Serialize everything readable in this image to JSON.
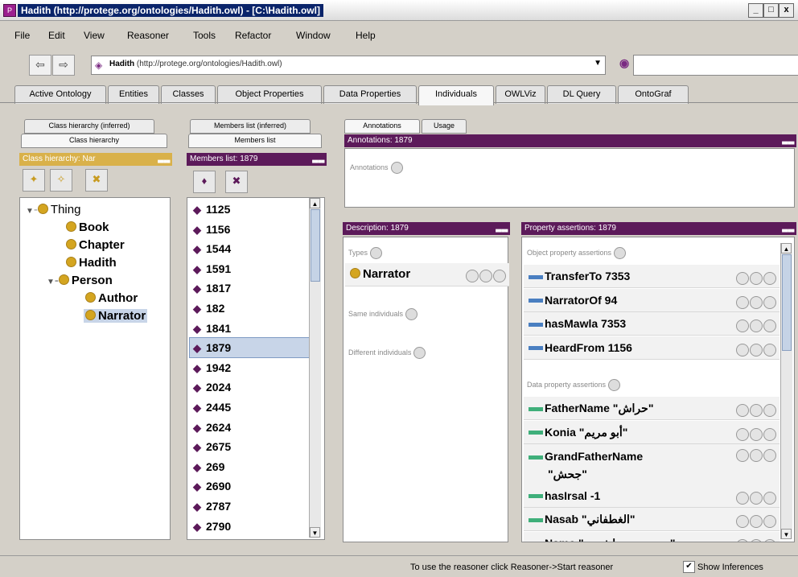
{
  "window": {
    "title": "Hadith (http://protege.org/ontologies/Hadith.owl) - [C:\\Hadith.owl]",
    "controls": [
      "_",
      "□",
      "x"
    ]
  },
  "menu": [
    "File",
    "Edit",
    "View",
    "Reasoner",
    "Tools",
    "Refactor",
    "Window",
    "Help"
  ],
  "nav": {
    "ontology_name": "Hadith",
    "ontology_iri": "(http://protege.org/ontologies/Hadith.owl)",
    "search_value": ""
  },
  "tabs": [
    "Active Ontology",
    "Entities",
    "Classes",
    "Object Properties",
    "Data Properties",
    "Individuals",
    "OWLViz",
    "DL Query",
    "OntoGraf"
  ],
  "active_tab": "Individuals",
  "class_panel": {
    "tab_inferred": "Class hierarchy (inferred)",
    "tab_asserted": "Class hierarchy",
    "header": "Class hierarchy: Nar",
    "tree": {
      "root": "Thing",
      "book": "Book",
      "chapter": "Chapter",
      "hadith": "Hadith",
      "person": "Person",
      "author": "Author",
      "narrator": "Narrator"
    }
  },
  "members_panel": {
    "tab_inferred": "Members list (inferred)",
    "tab_asserted": "Members list",
    "header": "Members list: 1879",
    "items": [
      "1125",
      "1156",
      "1544",
      "1591",
      "1817",
      "182",
      "1841",
      "1879",
      "1942",
      "2024",
      "2445",
      "2624",
      "2675",
      "269",
      "2690",
      "2787",
      "2790"
    ],
    "selected": "1879"
  },
  "annotations_panel": {
    "tab_annotations": "Annotations",
    "tab_usage": "Usage",
    "header": "Annotations: 1879",
    "label": "Annotations"
  },
  "description_panel": {
    "header": "Description: 1879",
    "types_label": "Types",
    "type_value": "Narrator",
    "same_label": "Same individuals",
    "different_label": "Different individuals"
  },
  "property_panel": {
    "header": "Property assertions: 1879",
    "object_label": "Object property assertions",
    "object_assertions": [
      {
        "text": "TransferTo  7353"
      },
      {
        "text": "NarratorOf  94"
      },
      {
        "text": "hasMawla  7353"
      },
      {
        "text": "HeardFrom  1156"
      }
    ],
    "data_label": "Data property assertions",
    "data_assertions": [
      {
        "line1": "FatherName  \"حراش\""
      },
      {
        "line1": "Konia  \"أبو مريم\""
      },
      {
        "line1": "GrandFatherName",
        "line2": "\"جحش\""
      },
      {
        "line1": "hasIrsal  -1"
      },
      {
        "line1": "Nasab  \"الغطفاني\""
      },
      {
        "line1": "Name  \"ربعي بن حراش بن\""
      }
    ]
  },
  "colors": {
    "panel_header": "#5c1a5a",
    "class_header": "#d9b14a",
    "object_prop": "#4a7fc1",
    "data_prop": "#3faf7a",
    "individual": "#5c1a5a",
    "class": "#d4a520"
  },
  "status": {
    "message": "To use the reasoner click Reasoner->Start reasoner",
    "show_inferences_label": "Show Inferences",
    "show_inferences_checked": true
  }
}
